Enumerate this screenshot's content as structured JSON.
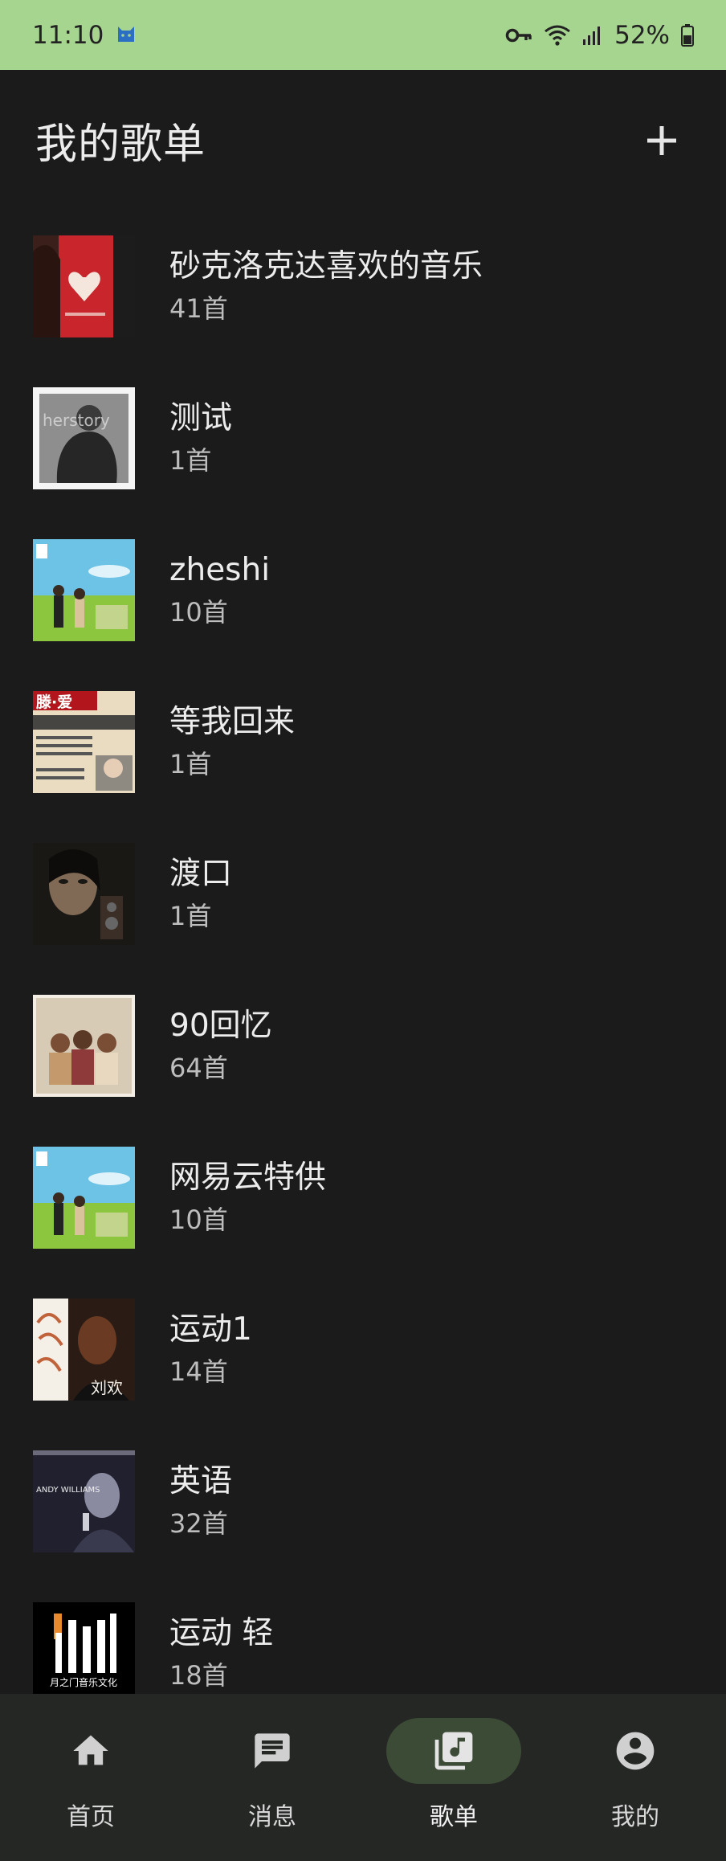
{
  "status_bar": {
    "time": "11:10",
    "battery": "52%",
    "icons": [
      "cat-icon",
      "key-icon",
      "wifi-icon",
      "signal-icon",
      "battery-icon"
    ]
  },
  "header": {
    "title": "我的歌单",
    "add_icon": "plus-icon"
  },
  "playlists": [
    {
      "name": "砂克洛克达喜欢的音乐",
      "count": "41首",
      "cover_text": "",
      "colors": [
        "#c9252c",
        "#f4e6dc"
      ]
    },
    {
      "name": "测试",
      "count": "1首",
      "cover_text": "herstory",
      "colors": [
        "#6e6e6e",
        "#2a2a2a"
      ]
    },
    {
      "name": "zheshi",
      "count": "10首",
      "cover_text": "",
      "colors": [
        "#6cc3e6",
        "#8cc63f"
      ]
    },
    {
      "name": "等我回来",
      "count": "1首",
      "cover_text": "滕·爱",
      "colors": [
        "#e9dcc0",
        "#b2151b"
      ]
    },
    {
      "name": "渡口",
      "count": "1首",
      "cover_text": "",
      "colors": [
        "#2a261f",
        "#806a55"
      ]
    },
    {
      "name": "90回忆",
      "count": "64首",
      "cover_text": "",
      "colors": [
        "#d8cbb6",
        "#7a4e34"
      ]
    },
    {
      "name": "网易云特供",
      "count": "10首",
      "cover_text": "",
      "colors": [
        "#6cc3e6",
        "#8cc63f"
      ]
    },
    {
      "name": "运动1",
      "count": "14首",
      "cover_text": "刘欢",
      "colors": [
        "#f4efe7",
        "#6a3b22"
      ]
    },
    {
      "name": "英语",
      "count": "32首",
      "cover_text": "ANDY WILLIAMS",
      "colors": [
        "#20202e",
        "#8a8aa0"
      ]
    },
    {
      "name": "运动 轻",
      "count": "18首",
      "cover_text": "月之门音乐文化",
      "colors": [
        "#000000",
        "#ffffff"
      ]
    }
  ],
  "nav": {
    "items": [
      {
        "label": "首页",
        "icon": "home-icon"
      },
      {
        "label": "消息",
        "icon": "message-icon"
      },
      {
        "label": "歌单",
        "icon": "library-music-icon"
      },
      {
        "label": "我的",
        "icon": "account-icon"
      }
    ],
    "active_index": 2
  },
  "colors": {
    "background": "#1b1b1b",
    "status_bar": "#a6d58f",
    "nav_background": "#252725",
    "nav_active_pill": "#3c4b36"
  }
}
